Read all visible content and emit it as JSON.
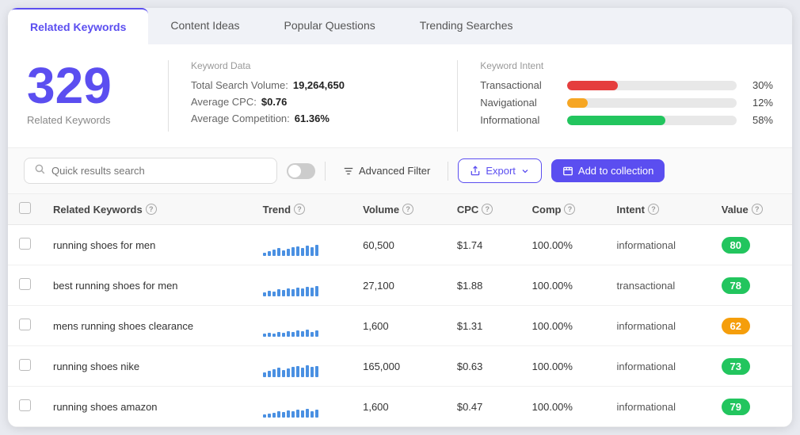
{
  "tabs": [
    {
      "id": "related-keywords",
      "label": "Related Keywords",
      "active": true
    },
    {
      "id": "content-ideas",
      "label": "Content Ideas",
      "active": false
    },
    {
      "id": "popular-questions",
      "label": "Popular Questions",
      "active": false
    },
    {
      "id": "trending-searches",
      "label": "Trending Searches",
      "active": false
    }
  ],
  "summary": {
    "count": "329",
    "count_label": "Related Keywords",
    "keyword_data_title": "Keyword Data",
    "total_search_volume_label": "Total Search Volume:",
    "total_search_volume_value": "19,264,650",
    "avg_cpc_label": "Average CPC:",
    "avg_cpc_value": "$0.76",
    "avg_competition_label": "Average Competition:",
    "avg_competition_value": "61.36%",
    "keyword_intent_title": "Keyword Intent",
    "intent": [
      {
        "label": "Transactional",
        "pct": "30%",
        "width": 30,
        "color": "#e53e3e"
      },
      {
        "label": "Navigational",
        "pct": "12%",
        "width": 12,
        "color": "#f6a623"
      },
      {
        "label": "Informational",
        "pct": "58%",
        "width": 58,
        "color": "#22c55e"
      }
    ]
  },
  "toolbar": {
    "search_placeholder": "Quick results search",
    "advanced_filter_label": "Advanced Filter",
    "export_label": "Export",
    "add_collection_label": "Add to collection"
  },
  "table": {
    "headers": [
      {
        "id": "keyword",
        "label": "Related Keywords"
      },
      {
        "id": "trend",
        "label": "Trend"
      },
      {
        "id": "volume",
        "label": "Volume"
      },
      {
        "id": "cpc",
        "label": "CPC"
      },
      {
        "id": "comp",
        "label": "Comp"
      },
      {
        "id": "intent",
        "label": "Intent"
      },
      {
        "id": "value",
        "label": "Value"
      }
    ],
    "rows": [
      {
        "keyword": "running shoes for men",
        "trend_heights": [
          4,
          6,
          8,
          10,
          7,
          9,
          11,
          12,
          10,
          13,
          11,
          14
        ],
        "volume": "60,500",
        "cpc": "$1.74",
        "comp": "100.00%",
        "intent": "informational",
        "value": "80",
        "badge_color": "green"
      },
      {
        "keyword": "best running shoes for men",
        "trend_heights": [
          5,
          7,
          6,
          9,
          8,
          10,
          9,
          11,
          10,
          12,
          11,
          13
        ],
        "volume": "27,100",
        "cpc": "$1.88",
        "comp": "100.00%",
        "intent": "transactional",
        "value": "78",
        "badge_color": "green"
      },
      {
        "keyword": "mens running shoes clearance",
        "trend_heights": [
          3,
          5,
          4,
          6,
          5,
          7,
          6,
          8,
          7,
          9,
          6,
          8
        ],
        "volume": "1,600",
        "cpc": "$1.31",
        "comp": "100.00%",
        "intent": "informational",
        "value": "62",
        "badge_color": "orange"
      },
      {
        "keyword": "running shoes nike",
        "trend_heights": [
          6,
          8,
          10,
          12,
          9,
          11,
          13,
          14,
          12,
          15,
          13,
          14
        ],
        "volume": "165,000",
        "cpc": "$0.63",
        "comp": "100.00%",
        "intent": "informational",
        "value": "73",
        "badge_color": "green"
      },
      {
        "keyword": "running shoes amazon",
        "trend_heights": [
          4,
          5,
          6,
          8,
          7,
          9,
          8,
          10,
          9,
          11,
          8,
          10
        ],
        "volume": "1,600",
        "cpc": "$0.47",
        "comp": "100.00%",
        "intent": "informational",
        "value": "79",
        "badge_color": "green"
      }
    ]
  }
}
